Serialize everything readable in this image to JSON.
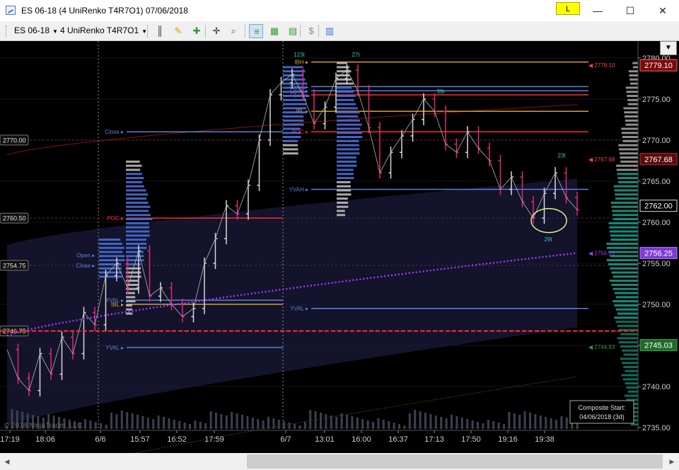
{
  "window": {
    "title": "ES 06-18 (4 UniRenko T4R7O1)  07/06/2018",
    "link_label": "L",
    "minimize_glyph": "—",
    "maximize_glyph": "☐",
    "close_glyph": "✕"
  },
  "toolbar": {
    "instrument": "ES 06-18",
    "bar_type": "4 UniRenko T4R7O1",
    "tools": [
      {
        "name": "bar-style-icon",
        "glyph": "║",
        "color": "#222222",
        "active": false
      },
      {
        "name": "drawing-tools-icon",
        "glyph": "✎",
        "color": "#d7a400",
        "active": false
      },
      {
        "name": "add-indicator-icon",
        "glyph": "✚",
        "color": "#2f9f2f",
        "active": false
      },
      {
        "name": "crosshair-icon",
        "glyph": "✛",
        "color": "#222222",
        "active": false
      },
      {
        "name": "zoom-icon",
        "glyph": "⌕",
        "color": "#2a6db0",
        "active": false
      },
      {
        "name": "indicators-icon",
        "glyph": "≡",
        "color": "#2f9f2f",
        "active": true
      },
      {
        "name": "strategies-icon",
        "glyph": "▦",
        "color": "#2f9f2f",
        "active": false
      },
      {
        "name": "templates-icon",
        "glyph": "▤",
        "color": "#2f9f2f",
        "active": false
      },
      {
        "name": "chart-trader-icon",
        "glyph": "$",
        "color": "#888888",
        "active": false
      },
      {
        "name": "properties-icon",
        "glyph": "▥",
        "color": "#3b6fd6",
        "active": false
      }
    ]
  },
  "colors": {
    "background": "#000000",
    "bull_bar": "#d8d8d8",
    "bear_bar": "#e0287a",
    "vwap": "#a23bff",
    "band_fill": "#1a1a3a",
    "poc": "#ff2a2a",
    "value_area": "#4a6fd6",
    "yesterday_level": "#5b82d6",
    "ib_level": "#d6a030",
    "axis_text": "#d0d0d0"
  },
  "chart_data": {
    "type": "candlestick",
    "ylim": [
      2735.0,
      2780.5
    ],
    "price_axis_ticks": [
      2780.0,
      2775.0,
      2770.0,
      2765.0,
      2760.0,
      2755.0,
      2750.0,
      2745.0,
      2740.0,
      2735.0
    ],
    "price_axis_labels": [
      "2780.00",
      "2775.00",
      "2770.00",
      "2765.00",
      "2760.00",
      "2755.00",
      "2750.00",
      "2745.00",
      "2740.00",
      "2735.00"
    ],
    "time_labels": [
      "17:19",
      "18:06",
      "6/6",
      "15:57",
      "16:52",
      "17:59",
      "6/7",
      "13:01",
      "16:00",
      "16:37",
      "17:13",
      "17:50",
      "19:16",
      "19:38"
    ],
    "path": [
      2744.5,
      2741.0,
      2739.5,
      2744.0,
      2741.5,
      2746.0,
      2744.0,
      2749.0,
      2747.5,
      2753.5,
      2755.0,
      2752.0,
      2756.5,
      2751.0,
      2752.0,
      2750.0,
      2748.5,
      2749.5,
      2755.0,
      2758.0,
      2762.0,
      2761.0,
      2764.5,
      2770.0,
      2775.5,
      2777.0,
      2778.0,
      2775.5,
      2772.0,
      2774.0,
      2777.5,
      2778.5,
      2776.0,
      2771.5,
      2766.0,
      2768.5,
      2770.5,
      2772.5,
      2775.0,
      2773.5,
      2769.5,
      2768.5,
      2771.0,
      2769.0,
      2767.5,
      2764.0,
      2765.5,
      2762.5,
      2760.5,
      2763.5,
      2766.0,
      2763.0,
      2761.5
    ],
    "vwap_start": 2746.2,
    "vwap_end": 2756.25,
    "price_flags": [
      {
        "label": "2779.10",
        "value": 2779.1,
        "style": "red"
      },
      {
        "label": "2767.68",
        "value": 2767.68,
        "style": "dark-red"
      },
      {
        "label": "2762.00",
        "value": 2762.0,
        "style": "white"
      },
      {
        "label": "2756.25",
        "value": 2756.25,
        "style": "purple"
      },
      {
        "label": "2745.03",
        "value": 2745.03,
        "style": "green"
      }
    ],
    "right_level_labels": [
      {
        "label": "2779.10",
        "value": 2779.1,
        "color": "#ff4040"
      },
      {
        "label": "2767.68",
        "value": 2767.68,
        "color": "#ff4040"
      },
      {
        "label": "2756.25",
        "value": 2756.25,
        "color": "#a23bff"
      },
      {
        "label": "2744.83",
        "value": 2744.83,
        "color": "#2fa02f"
      }
    ],
    "left_level_tags": [
      {
        "label": "2770.00",
        "value": 2770.0
      },
      {
        "label": "2760.50",
        "value": 2760.5
      },
      {
        "label": "2754.75",
        "value": 2754.75
      },
      {
        "label": "2746.75",
        "value": 2746.75
      }
    ],
    "sessions": [
      {
        "date_label": "6/6",
        "levels": [
          {
            "label": "Close",
            "value": 2771.0,
            "color": "#5b82d6"
          },
          {
            "label": "POC",
            "value": 2760.5,
            "color": "#ff2a2a"
          },
          {
            "label": "YVAL",
            "value": 2750.5,
            "color": "#5b82d6"
          },
          {
            "label": "IBL",
            "value": 2750.0,
            "color": "#d6a030"
          },
          {
            "label": "YVAL",
            "value": 2744.75,
            "color": "#5b82d6"
          }
        ]
      },
      {
        "date_label": "6/7",
        "levels": [
          {
            "label": "IBH",
            "value": 2779.5,
            "color": "#d6a030"
          },
          {
            "label": "Close",
            "value": 2776.5,
            "color": "#5b82d6"
          },
          {
            "label": "Open",
            "value": 2775.5,
            "color": "#ff2a2a"
          },
          {
            "label": "Open",
            "value": 2776.0,
            "color": "#5b82d6"
          },
          {
            "label": "IBL",
            "value": 2773.5,
            "color": "#d6a030"
          },
          {
            "label": "POC",
            "value": 2771.0,
            "color": "#ff2a2a"
          },
          {
            "label": "YVAH",
            "value": 2764.0,
            "color": "#5b82d6"
          },
          {
            "label": "YVAL",
            "value": 2749.5,
            "color": "#5b82d6"
          }
        ]
      }
    ],
    "early_session_labels": [
      {
        "label": "Open",
        "value": 2756.0
      },
      {
        "label": "Close",
        "value": 2754.75
      }
    ],
    "swing_labels": [
      {
        "label": "123t",
        "value": 2780.0
      },
      {
        "label": "27t",
        "value": 2780.0
      },
      {
        "label": "39t",
        "value": 2775.5
      },
      {
        "label": "23t",
        "value": 2767.7
      },
      {
        "label": "29t",
        "value": 2757.5
      }
    ],
    "composite_info": {
      "line1": "Composite Start:",
      "line2": "04/06/2018 (3d)"
    },
    "watermark": "© 2018 NinjaTrader, LLC"
  }
}
